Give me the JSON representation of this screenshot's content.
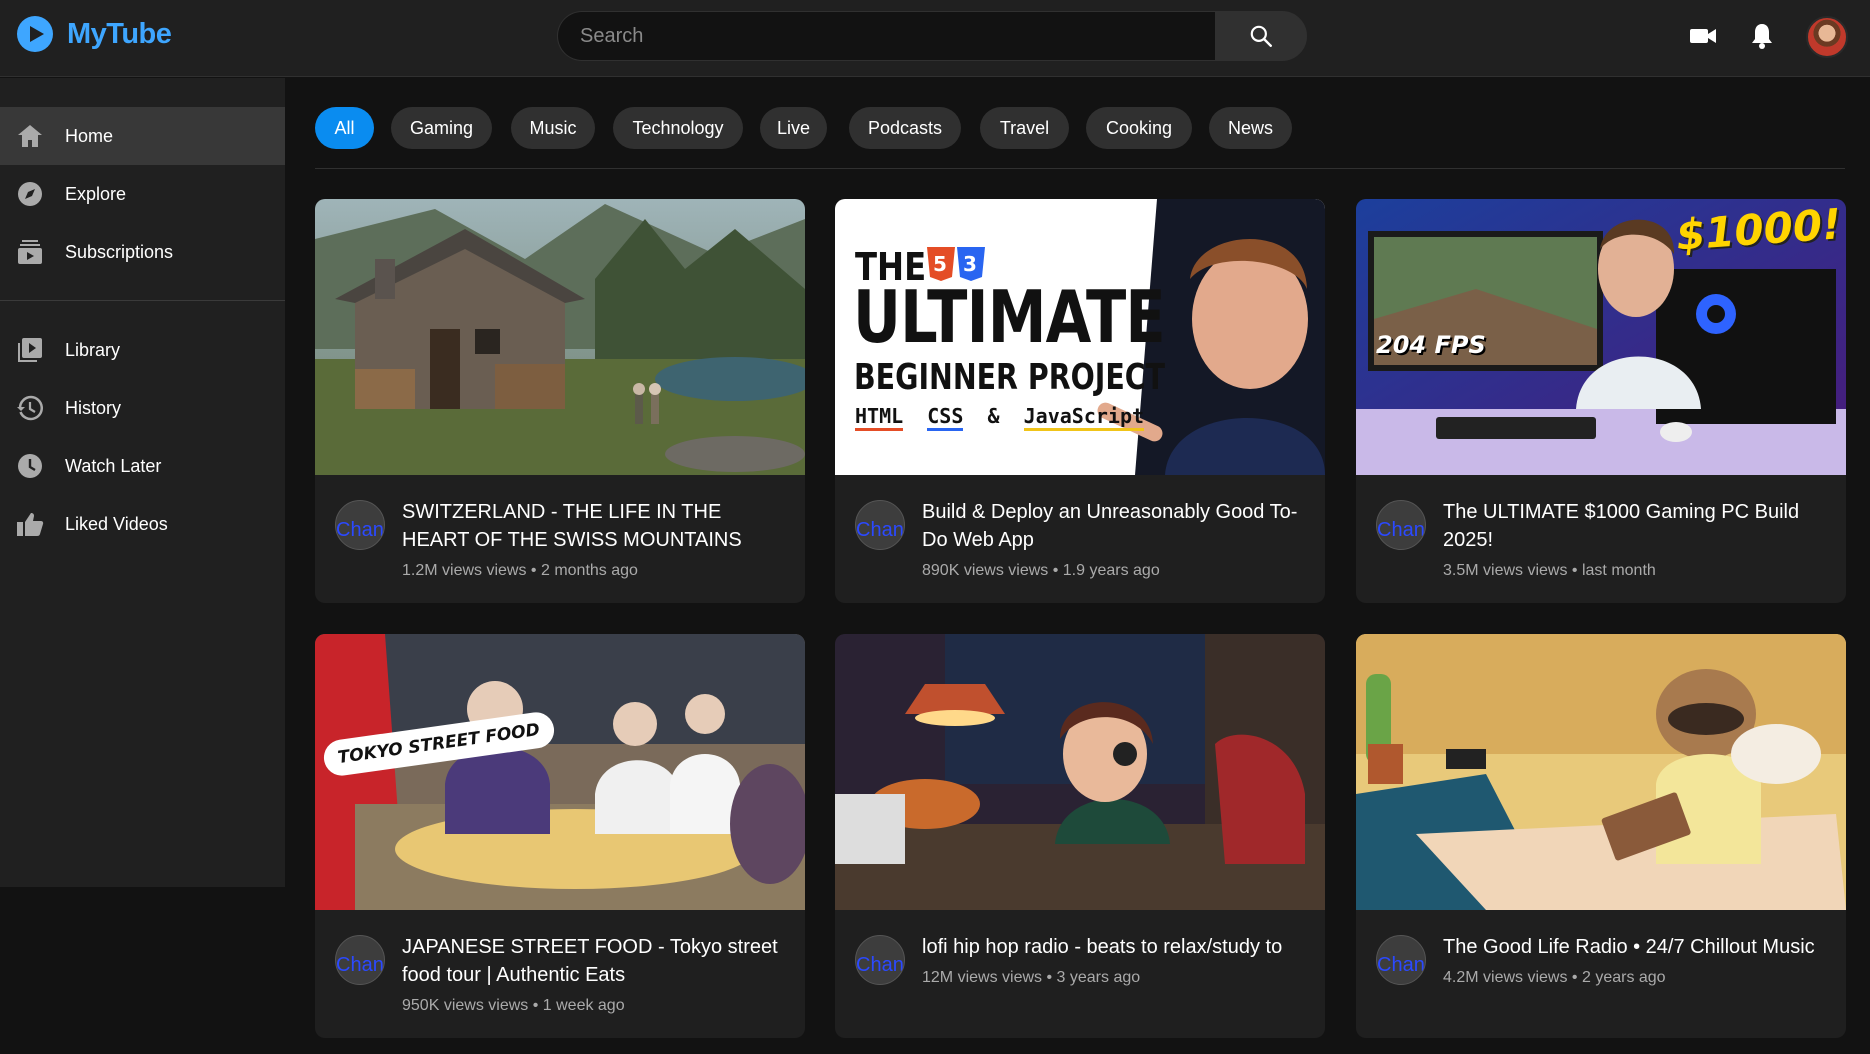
{
  "app": {
    "name": "MyTube"
  },
  "search": {
    "placeholder": "Search"
  },
  "sidebar": {
    "items": [
      {
        "label": "Home",
        "icon": "home-icon",
        "active": true
      },
      {
        "label": "Explore",
        "icon": "compass-icon",
        "active": false
      },
      {
        "label": "Subscriptions",
        "icon": "subscriptions-icon",
        "active": false
      },
      {
        "label": "Library",
        "icon": "library-icon",
        "active": false
      },
      {
        "label": "History",
        "icon": "history-icon",
        "active": false
      },
      {
        "label": "Watch Later",
        "icon": "clock-icon",
        "active": false
      },
      {
        "label": "Liked Videos",
        "icon": "thumbs-up-icon",
        "active": false
      }
    ]
  },
  "chips": [
    {
      "label": "All",
      "active": true
    },
    {
      "label": "Gaming",
      "active": false
    },
    {
      "label": "Music",
      "active": false
    },
    {
      "label": "Technology",
      "active": false
    },
    {
      "label": "Live",
      "active": false
    },
    {
      "label": "Podcasts",
      "active": false
    },
    {
      "label": "Travel",
      "active": false
    },
    {
      "label": "Cooking",
      "active": false
    },
    {
      "label": "News",
      "active": false
    }
  ],
  "videos": [
    {
      "title": "SWITZERLAND - THE LIFE IN THE HEART OF THE SWISS MOUNTAINS",
      "stats": "1.2M views views • 2 months ago",
      "avatar_alt": "Chan"
    },
    {
      "title": "Build & Deploy an Unreasonably Good To-Do Web App",
      "stats": "890K views views • 1.9 years ago",
      "avatar_alt": "Chan",
      "thumb_text": {
        "line1": "THE",
        "line2": "ULTIMATE",
        "line3": "BEGINNER PROJECT",
        "html": "HTML",
        "css": "CSS",
        "amp": "&",
        "js": "JavaScript"
      }
    },
    {
      "title": "The ULTIMATE $1000 Gaming PC Build 2025!",
      "stats": "3.5M views views • last month",
      "avatar_alt": "Chan",
      "thumb_text": {
        "price": "$1000!",
        "fps": "204 FPS"
      }
    },
    {
      "title": "JAPANESE STREET FOOD - Tokyo street food tour | Authentic Eats",
      "stats": "950K views views • 1 week ago",
      "avatar_alt": "Chan",
      "thumb_text": {
        "badge": "TOKYO STREET FOOD"
      }
    },
    {
      "title": "lofi hip hop radio - beats to relax/study to",
      "stats": "12M views views • 3 years ago",
      "avatar_alt": "Chan"
    },
    {
      "title": "The Good Life Radio • 24/7 Chillout Music",
      "stats": "4.2M views views • 2 years ago",
      "avatar_alt": "Chan"
    }
  ],
  "colors": {
    "accent": "#3ea6ff",
    "chip_active": "#0a8cf0",
    "background": "#121212",
    "surface": "#202020"
  }
}
